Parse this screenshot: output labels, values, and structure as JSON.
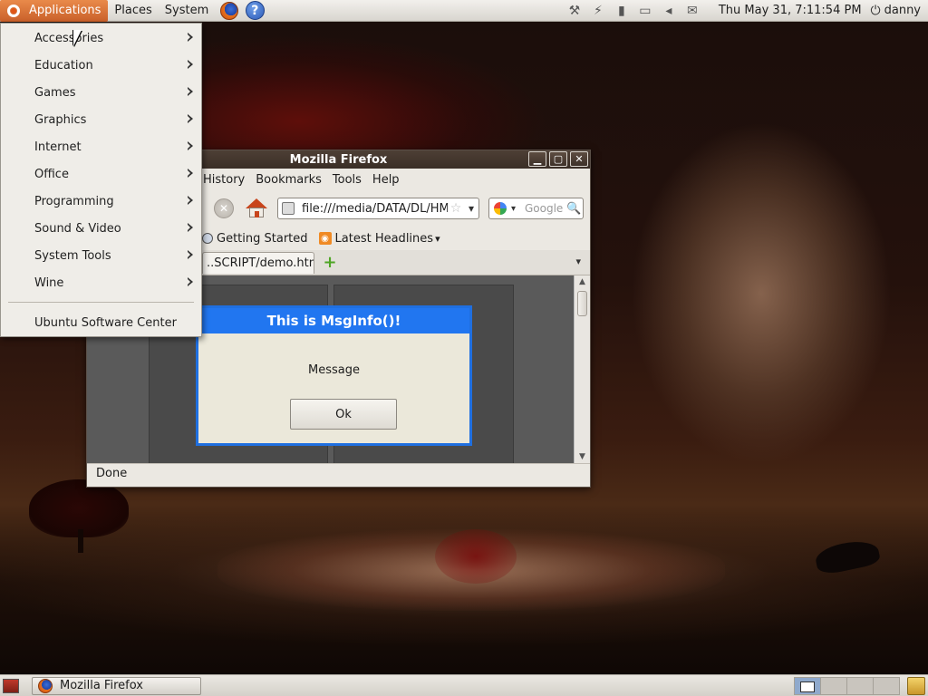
{
  "top_panel": {
    "applications": "Applications",
    "places": "Places",
    "system": "System",
    "launchers": [
      "firefox-icon",
      "help-icon"
    ],
    "tray_icons": [
      "network-tools-icon",
      "network-plug-icon",
      "battery-icon",
      "display-icon",
      "volume-icon",
      "mail-icon"
    ],
    "clock": "Thu May 31,  7:11:54 PM",
    "user": "danny"
  },
  "apps_menu": {
    "items": [
      {
        "label": "Accessories",
        "submenu": true
      },
      {
        "label": "Education",
        "submenu": true
      },
      {
        "label": "Games",
        "submenu": true
      },
      {
        "label": "Graphics",
        "submenu": true
      },
      {
        "label": "Internet",
        "submenu": true
      },
      {
        "label": "Office",
        "submenu": true
      },
      {
        "label": "Programming",
        "submenu": true
      },
      {
        "label": "Sound & Video",
        "submenu": true
      },
      {
        "label": "System Tools",
        "submenu": true
      },
      {
        "label": "Wine",
        "submenu": true
      }
    ],
    "footer_item": "Ubuntu Software Center"
  },
  "firefox": {
    "title": "Mozilla Firefox",
    "menubar": [
      "History",
      "Bookmarks",
      "Tools",
      "Help"
    ],
    "url": "file:///media/DATA/DL/HMC",
    "search_placeholder": "Google",
    "bookmarks": [
      "Getting Started",
      "Latest Headlines"
    ],
    "tab_label": "..SCRIPT/demo.html",
    "status": "Done"
  },
  "dialog": {
    "title": "This is MsgInfo()!",
    "message": "Message",
    "ok_label": "Ok"
  },
  "bottom_panel": {
    "task_label": "Mozilla Firefox",
    "workspace_count": 4,
    "active_workspace": 1
  },
  "colors": {
    "applications_accent": "#d26b33",
    "dialog_blue": "#2176f0",
    "titlebar": "#3f3229"
  }
}
